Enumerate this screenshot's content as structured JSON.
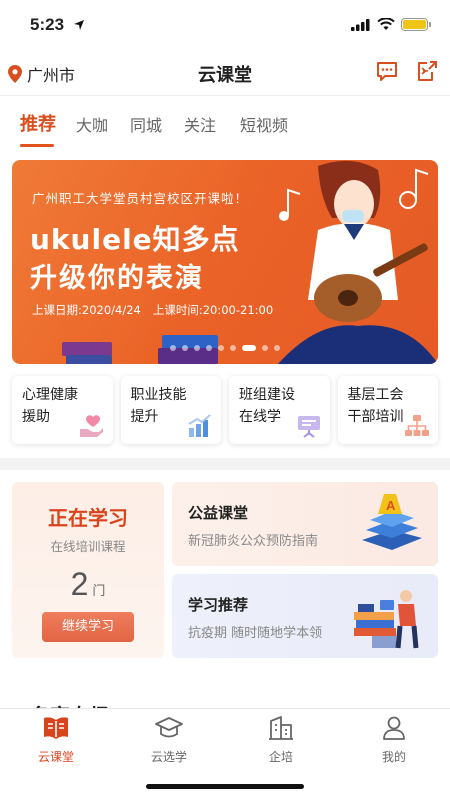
{
  "status": {
    "time": "5:23"
  },
  "header": {
    "location": "广州市",
    "title": "云课堂"
  },
  "tabs": [
    {
      "label": "推荐",
      "active": true
    },
    {
      "label": "大咖"
    },
    {
      "label": "同城"
    },
    {
      "label": "关注"
    },
    {
      "label": "短视频"
    }
  ],
  "banner": {
    "top_text": "广州职工大学堂员村宫校区开课啦！",
    "line1": "ukulele知多点",
    "line2": "升级你的表演",
    "date": "上课日期:2020/4/24",
    "time": "上课时间:20:00-21:00"
  },
  "categories": [
    {
      "label": "心理健康\n援助",
      "icon": "heart-hand-icon"
    },
    {
      "label": "职业技能\n提升",
      "icon": "bar-chart-icon"
    },
    {
      "label": "班组建设\n在线学",
      "icon": "presentation-board-icon"
    },
    {
      "label": "基层工会\n干部培训",
      "icon": "org-chart-icon"
    }
  ],
  "study": {
    "title": "正在学习",
    "subtitle": "在线培训课程",
    "count": "2",
    "unit": "门",
    "button": "继续学习"
  },
  "promos": [
    {
      "title": "公益课堂",
      "subtitle": "新冠肺炎公众预防指南"
    },
    {
      "title": "学习推荐",
      "subtitle": "抗疫期 随时随地学本领"
    }
  ],
  "section_peek": "名家专场",
  "bottom_nav": [
    {
      "label": "云课堂",
      "icon": "book-icon",
      "active": true
    },
    {
      "label": "云选学",
      "icon": "graduation-cap-icon"
    },
    {
      "label": "企培",
      "icon": "building-icon"
    },
    {
      "label": "我的",
      "icon": "person-icon"
    }
  ],
  "colors": {
    "accent": "#d8501f",
    "banner": "#ea6227"
  }
}
